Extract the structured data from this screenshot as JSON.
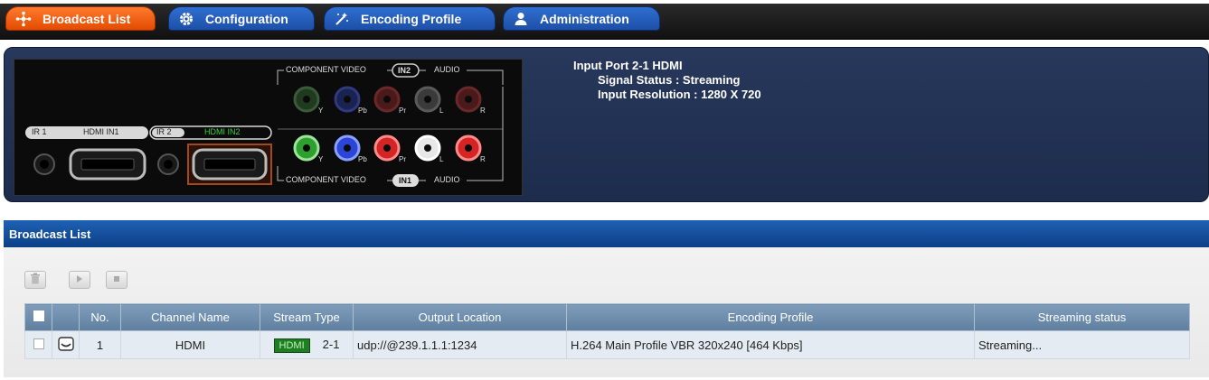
{
  "nav": {
    "tabs": [
      {
        "label": "Broadcast List",
        "icon": "network-icon",
        "active": true
      },
      {
        "label": "Configuration",
        "icon": "gear-icon",
        "active": false
      },
      {
        "label": "Encoding Profile",
        "icon": "wand-icon",
        "active": false
      },
      {
        "label": "Administration",
        "icon": "user-icon",
        "active": false
      }
    ]
  },
  "device": {
    "component_video_top": "COMPONENT VIDEO",
    "in2_badge": "IN2",
    "audio_top": "AUDIO",
    "component_video_bottom": "COMPONENT VIDEO",
    "in1_badge": "IN1",
    "audio_bottom": "AUDIO",
    "ir1_label": "IR 1",
    "hdmi_in1_label": "HDMI IN1",
    "ir2_label": "IR 2",
    "hdmi_in2_label": "HDMI IN2",
    "jack_labels": [
      "Y",
      "Pb",
      "Pr",
      "L",
      "R"
    ]
  },
  "input_info": {
    "port": "Input Port 2-1  HDMI",
    "signal_status": "Signal Status : Streaming",
    "resolution": "Input Resolution : 1280 X 720"
  },
  "broadcast_list": {
    "title": "Broadcast List",
    "toolbar": {
      "delete_icon": "trash-icon",
      "play_icon": "play-icon",
      "stop_icon": "stop-icon"
    },
    "columns": {
      "no": "No.",
      "channel_name": "Channel Name",
      "stream_type": "Stream Type",
      "output_location": "Output Location",
      "encoding_profile": "Encoding Profile",
      "streaming_status": "Streaming status"
    },
    "rows": [
      {
        "no": "1",
        "channel_name": "HDMI",
        "stream_badge": "HDMI",
        "stream_port": "2-1",
        "output_location": "udp://@239.1.1.1:1234",
        "encoding_profile": "H.264 Main Profile VBR 320x240 [464 Kbps]",
        "streaming_status": "Streaming..."
      }
    ]
  },
  "colors": {
    "active_tab": "#e24c00",
    "tab": "#1d4fa8",
    "panel": "#1d2c4c",
    "list_header": "#0c3f86",
    "stream_badge": "#1f7d24"
  }
}
